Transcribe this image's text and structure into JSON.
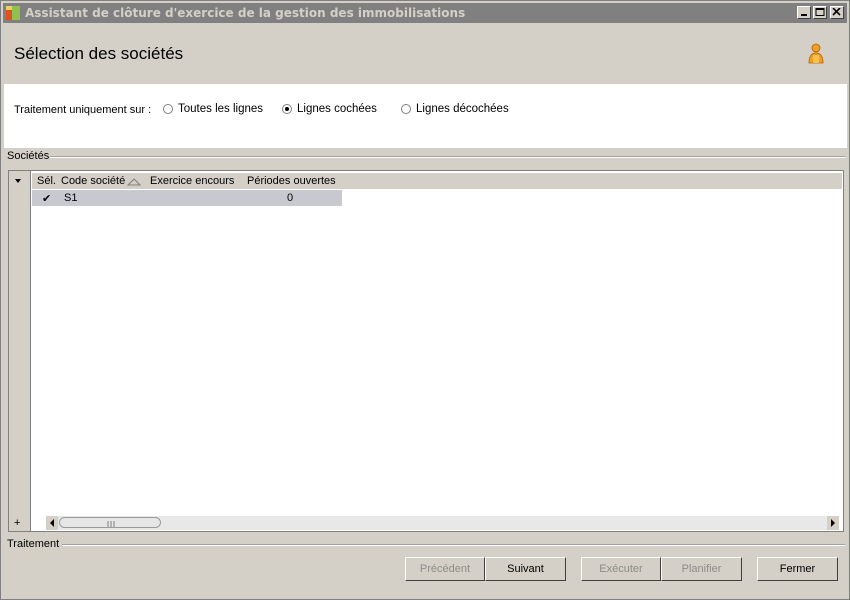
{
  "window": {
    "title": "Assistant de clôture d'exercice de la gestion des immobilisations",
    "controls": {
      "minimize": "minimize-icon",
      "maximize": "maximize-icon",
      "close": "close-icon"
    }
  },
  "header": {
    "title": "Sélection des sociétés",
    "icon": "user-icon"
  },
  "options": {
    "label": "Traitement uniquement sur :",
    "radios": [
      {
        "label": "Toutes les lignes",
        "checked": false
      },
      {
        "label": "Lignes cochées",
        "checked": true
      },
      {
        "label": "Lignes décochées",
        "checked": false
      }
    ]
  },
  "companies": {
    "group_label": "Sociétés",
    "columns": [
      "Sél.",
      "Code société",
      "Exercice encours",
      "Périodes ouvertes"
    ],
    "rows": [
      {
        "selected": "✔",
        "code": "S1",
        "exercice": "",
        "periodes": "0"
      }
    ],
    "add_button": "+"
  },
  "processing": {
    "group_label": "Traitement"
  },
  "buttons": {
    "previous": "Précédent",
    "next": "Suivant",
    "execute": "Exécuter",
    "schedule": "Planifier",
    "close": "Fermer"
  },
  "colors": {
    "titlebar": "#808080",
    "row_highlight": "#c8c8d0",
    "user_icon": "#f0a020"
  }
}
